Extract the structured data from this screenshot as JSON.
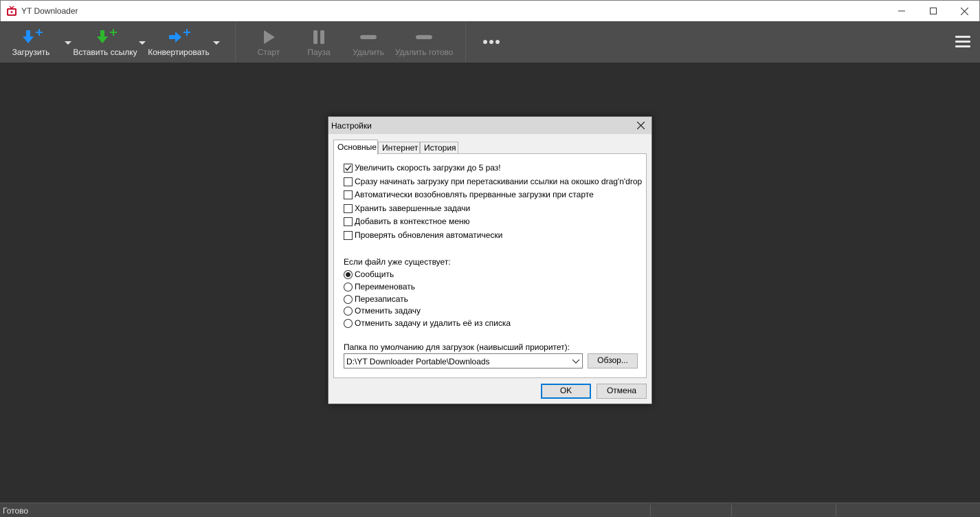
{
  "window": {
    "title": "YT Downloader"
  },
  "toolbar": {
    "items": [
      {
        "label": "Загрузить",
        "icon": "download-plus-icon",
        "enabled": true
      },
      {
        "label": "Вставить ссылку",
        "icon": "paste-link-icon",
        "enabled": true
      },
      {
        "label": "Конвертировать",
        "icon": "convert-icon",
        "enabled": true
      },
      {
        "label": "Старт",
        "icon": "play-icon",
        "enabled": false
      },
      {
        "label": "Пауза",
        "icon": "pause-icon",
        "enabled": false
      },
      {
        "label": "Удалить",
        "icon": "minus-icon",
        "enabled": false
      },
      {
        "label": "Удалить готово",
        "icon": "minus-icon",
        "enabled": false
      }
    ],
    "more_icon": "more-dots-icon",
    "menu_icon": "hamburger-menu-icon"
  },
  "status": {
    "text": "Готово"
  },
  "dialog": {
    "title": "Настройки",
    "tabs": [
      {
        "label": "Основные",
        "active": true
      },
      {
        "label": "Интернет",
        "active": false
      },
      {
        "label": "История",
        "active": false
      }
    ],
    "options": [
      {
        "label": "Увеличить скорость загрузки до 5 раз!",
        "checked": true
      },
      {
        "label": "Сразу начинать загрузку при перетаскивании ссылки на окошко drag'n'drop",
        "checked": false
      },
      {
        "label": "Автоматически возобновлять прерванные загрузки при старте",
        "checked": false
      },
      {
        "label": "Хранить завершенные задачи",
        "checked": false
      },
      {
        "label": "Добавить в контекстное меню",
        "checked": false
      },
      {
        "label": "Проверять обновления автоматически",
        "checked": false
      }
    ],
    "exists_label": "Если файл уже существует:",
    "exists_options": [
      {
        "label": "Сообщить",
        "selected": true
      },
      {
        "label": "Переименовать",
        "selected": false
      },
      {
        "label": "Перезаписать",
        "selected": false
      },
      {
        "label": "Отменить задачу",
        "selected": false
      },
      {
        "label": "Отменить задачу и удалить её из списка",
        "selected": false
      }
    ],
    "folder_label": "Папка по умолчанию для загрузок (наивысший приоритет):",
    "folder_value": "D:\\YT Downloader Portable\\Downloads",
    "browse_label": "Обзор...",
    "ok_label": "OK",
    "cancel_label": "Отмена"
  },
  "colors": {
    "accent_blue": "#1e90ff",
    "accent_green": "#2db82d",
    "toolbar_bg": "#4d4d4d",
    "main_bg": "#2e2e2e"
  }
}
